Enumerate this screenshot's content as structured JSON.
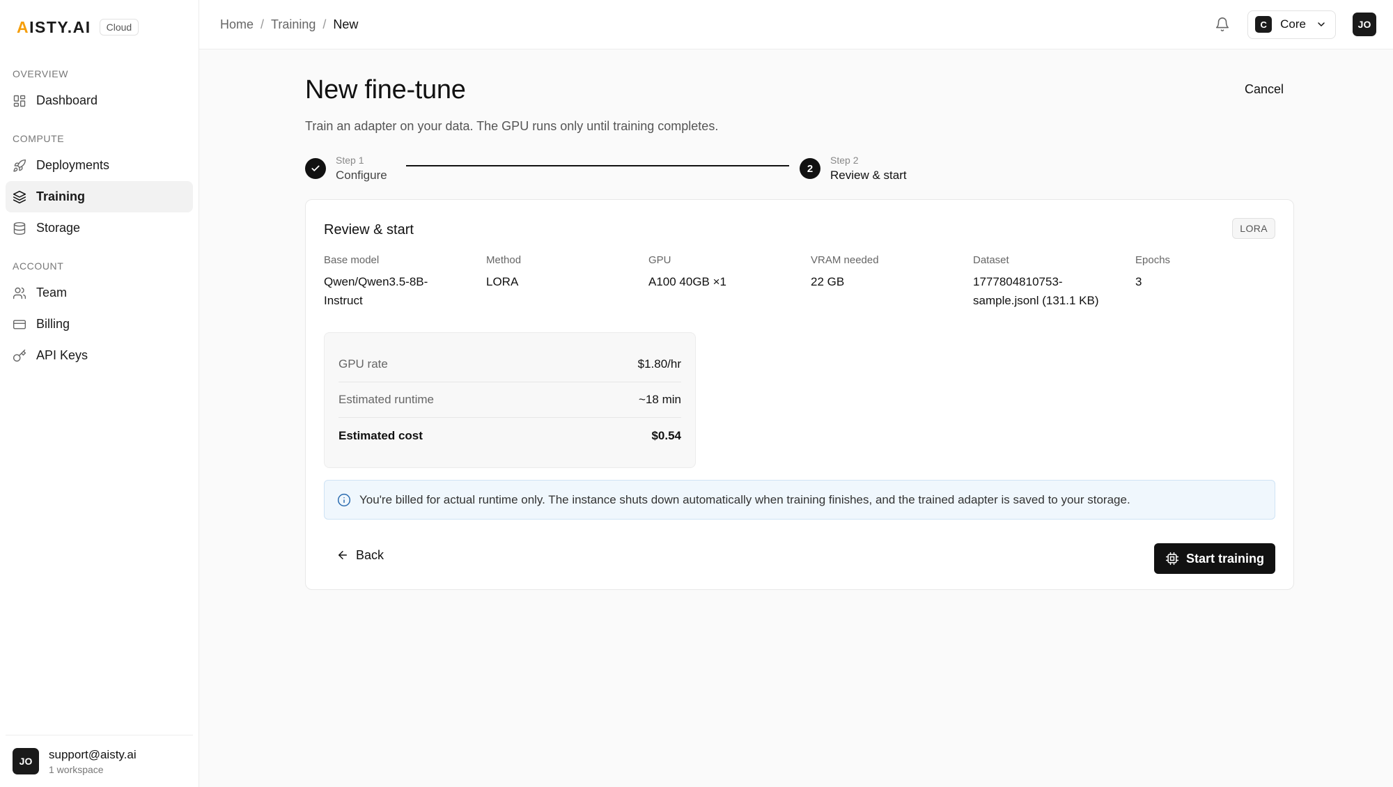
{
  "brand": {
    "logo_accent": "A",
    "logo_rest": "ISTY.AI",
    "badge": "Cloud",
    "accent_color": "#f59e0b"
  },
  "sidebar": {
    "sections": [
      {
        "title": "OVERVIEW",
        "items": [
          {
            "label": "Dashboard",
            "icon": "grid-icon"
          }
        ]
      },
      {
        "title": "COMPUTE",
        "items": [
          {
            "label": "Deployments",
            "icon": "rocket-icon"
          },
          {
            "label": "Training",
            "icon": "layers-icon",
            "active": true
          },
          {
            "label": "Storage",
            "icon": "database-icon"
          }
        ]
      },
      {
        "title": "ACCOUNT",
        "items": [
          {
            "label": "Team",
            "icon": "users-icon"
          },
          {
            "label": "Billing",
            "icon": "credit-card-icon"
          },
          {
            "label": "API Keys",
            "icon": "key-icon"
          }
        ]
      }
    ],
    "user": {
      "initials": "JO",
      "email": "support@aisty.ai",
      "workspaces": "1 workspace"
    }
  },
  "topbar": {
    "breadcrumb": [
      "Home",
      "Training",
      "New"
    ],
    "breadcrumb_sep": "/",
    "workspace": {
      "initial": "C",
      "name": "Core"
    },
    "avatar": "JO"
  },
  "page": {
    "title": "New fine-tune",
    "subtitle": "Train an adapter on your data. The GPU runs only until training completes.",
    "cancel": "Cancel"
  },
  "stepper": {
    "steps": [
      {
        "label": "Step 1",
        "title": "Configure",
        "status": "complete"
      },
      {
        "label": "Step 2",
        "title": "Review & start",
        "status": "current",
        "number": "2"
      }
    ]
  },
  "review": {
    "title": "Review & start",
    "badge": "LORA",
    "details": [
      {
        "label": "Base model",
        "value": "Qwen/Qwen3.5-8B-\nInstruct"
      },
      {
        "label": "Method",
        "value": "LORA"
      },
      {
        "label": "GPU",
        "value": "A100 40GB ×1"
      },
      {
        "label": "VRAM needed",
        "value": "22 GB"
      },
      {
        "label": "Dataset",
        "value": "1777804810753-\nsample.jsonl (131.1 KB)"
      },
      {
        "label": "Epochs",
        "value": "3"
      }
    ],
    "cost": [
      {
        "label": "GPU rate",
        "value": "$1.80/hr"
      },
      {
        "label": "Estimated runtime",
        "value": "~18 min"
      },
      {
        "label": "Estimated cost",
        "value": "$0.54"
      }
    ],
    "info": "You're billed for actual runtime only. The instance shuts down automatically when training finishes, and the trained adapter is saved to your storage.",
    "back": "Back",
    "start": "Start training"
  }
}
